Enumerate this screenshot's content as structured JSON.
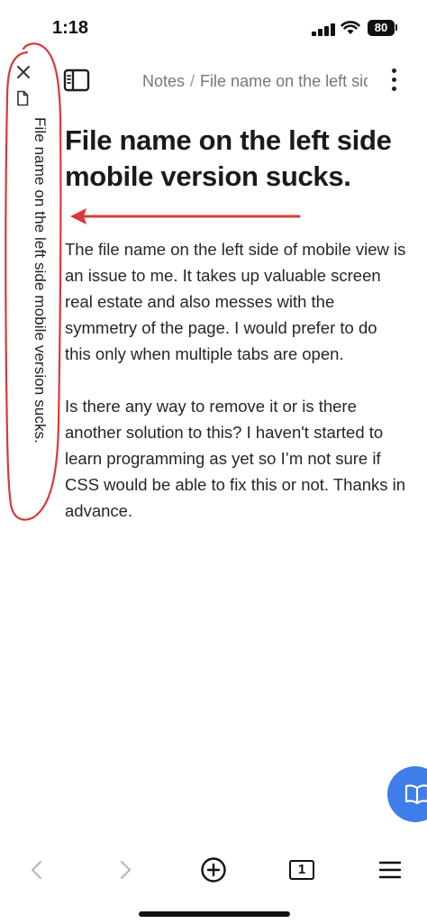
{
  "status_bar": {
    "time": "1:18",
    "battery": "80"
  },
  "side_tab": {
    "title": "File name on the left side mobile version sucks.",
    "close_icon": "close-icon",
    "doc_icon": "document-icon"
  },
  "header": {
    "breadcrumb_emoji": "memo-icon",
    "folder": "Notes",
    "separator": "/",
    "file": "File name on the left side mobile version sucks."
  },
  "note": {
    "title": "File name on the left side mobile version sucks.",
    "paragraphs": [
      "The file name on the left side of mobile view is an issue to me. It takes up valuable screen real estate and also messes with the symmetry of the page. I would prefer to do this only when multiple tabs are open.",
      "Is there any way to remove it or is there another solution to this? I haven't started to learn programming as yet so I’m not sure if CSS would be able to fix this or not. Thanks in advance."
    ]
  },
  "toolbar": {
    "tab_count": "1",
    "icons": [
      "chevron-left-icon",
      "chevron-right-icon",
      "plus-circle-icon",
      "tabs-icon",
      "menu-icon"
    ]
  },
  "colors": {
    "annotation_red": "#d83a3a",
    "fab_blue": "#3f7de8",
    "text": "#262626",
    "muted": "#777777"
  }
}
